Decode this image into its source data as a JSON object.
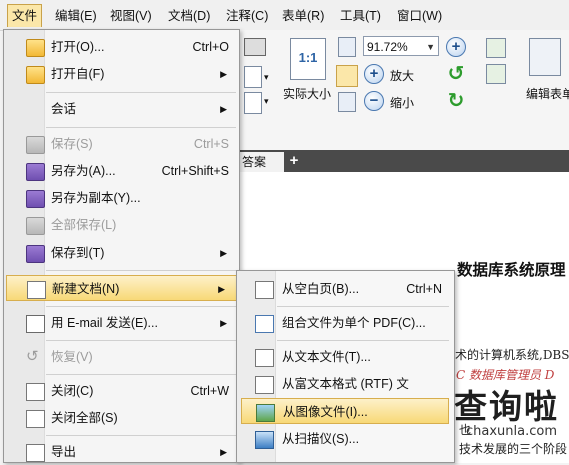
{
  "menubar": {
    "items": [
      "文件",
      "编辑(E)",
      "视图(V)",
      "文档(D)",
      "注释(C)",
      "表单(R)",
      "工具(T)",
      "窗口(W)"
    ]
  },
  "toolbar": {
    "zoom_value": "91.72%",
    "actual_size_label": "实际大小",
    "actual_size_icon_text": "1:1",
    "zoom_in_label": "放大",
    "zoom_out_label": "缩小",
    "edit_form_label": "编辑表单"
  },
  "tab": {
    "label": "答案",
    "add_symbol": "+"
  },
  "file_menu": {
    "items": [
      {
        "label": "打开(O)...",
        "shortcut": "Ctrl+O",
        "arrow": "",
        "icon": "folder-open-icon"
      },
      {
        "label": "打开自(F)",
        "shortcut": "",
        "arrow": "▶",
        "icon": "folder-web-icon"
      },
      {
        "label": "会话",
        "shortcut": "",
        "arrow": "▶",
        "icon": ""
      },
      {
        "label": "保存(S)",
        "shortcut": "Ctrl+S",
        "arrow": "",
        "icon": "save-icon"
      },
      {
        "label": "另存为(A)...",
        "shortcut": "Ctrl+Shift+S",
        "arrow": "",
        "icon": "save-as-icon"
      },
      {
        "label": "另存为副本(Y)...",
        "shortcut": "",
        "arrow": "",
        "icon": "save-copy-icon"
      },
      {
        "label": "全部保存(L)",
        "shortcut": "",
        "arrow": "",
        "icon": "save-all-icon"
      },
      {
        "label": "保存到(T)",
        "shortcut": "",
        "arrow": "▶",
        "icon": "save-to-icon"
      },
      {
        "label": "新建文档(N)",
        "shortcut": "",
        "arrow": "▶",
        "icon": "new-document-icon"
      },
      {
        "label": "用 E-mail 发送(E)...",
        "shortcut": "",
        "arrow": "▶",
        "icon": "email-icon"
      },
      {
        "label": "恢复(V)",
        "shortcut": "",
        "arrow": "",
        "icon": "revert-icon"
      },
      {
        "label": "关闭(C)",
        "shortcut": "Ctrl+W",
        "arrow": "",
        "icon": "close-document-icon"
      },
      {
        "label": "关闭全部(S)",
        "shortcut": "",
        "arrow": "",
        "icon": "close-all-icon"
      },
      {
        "label": "导出",
        "shortcut": "",
        "arrow": "▶",
        "icon": "export-icon"
      }
    ]
  },
  "new_doc_submenu": {
    "items": [
      {
        "label": "从空白页(B)...",
        "shortcut": "Ctrl+N",
        "icon": "blank-page-icon"
      },
      {
        "label": "组合文件为单个 PDF(C)...",
        "shortcut": "",
        "icon": "combine-pdf-icon"
      },
      {
        "label": "从文本文件(T)...",
        "shortcut": "",
        "icon": "text-file-icon"
      },
      {
        "label": "从富文本格式 (RTF) 文",
        "shortcut": "",
        "icon": "rtf-file-icon"
      },
      {
        "label": "从图像文件(I)...",
        "shortcut": "",
        "icon": "image-file-icon"
      },
      {
        "label": "从扫描仪(S)...",
        "shortcut": "",
        "icon": "scanner-icon"
      }
    ]
  },
  "document": {
    "heading": "数据库系统原理",
    "lines": [
      "术的计算机系统,DBS",
      "C  数据库管理员  D",
      "也",
      "技术发展的三个阶段"
    ]
  },
  "watermark": {
    "text": "查询啦",
    "url": "chaxunla.com"
  },
  "colors": {
    "highlight": "#f8d977",
    "menu_bg": "#f5f5f5",
    "tab_strip": "#4a4a4a"
  }
}
